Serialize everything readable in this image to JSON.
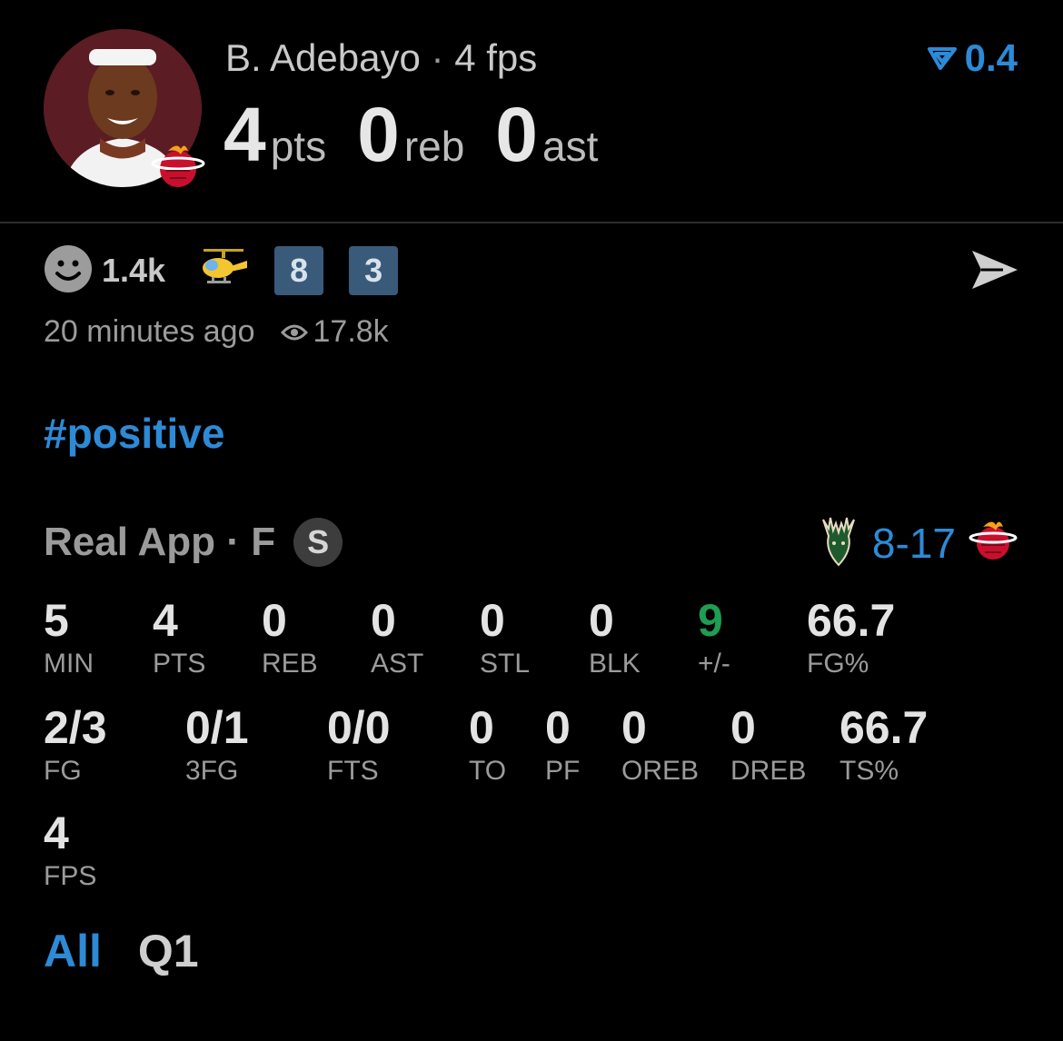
{
  "header": {
    "player_name": "B. Adebayo",
    "separator": "·",
    "fps_label": "4 fps",
    "stats": [
      {
        "value": "4",
        "unit": "pts"
      },
      {
        "value": "0",
        "unit": "reb"
      },
      {
        "value": "0",
        "unit": "ast"
      }
    ],
    "score_chip": "0.4"
  },
  "social": {
    "reaction_count": "1.4k",
    "badges": [
      "8",
      "3"
    ],
    "time_ago": "20 minutes ago",
    "views": "17.8k"
  },
  "hashtag": "#positive",
  "game": {
    "source": "Real App",
    "separator": "·",
    "status": "F",
    "status_badge": "S",
    "score": "8-17"
  },
  "stats_row1": [
    {
      "value": "5",
      "label": "MIN"
    },
    {
      "value": "4",
      "label": "PTS"
    },
    {
      "value": "0",
      "label": "REB"
    },
    {
      "value": "0",
      "label": "AST"
    },
    {
      "value": "0",
      "label": "STL"
    },
    {
      "value": "0",
      "label": "BLK"
    },
    {
      "value": "9",
      "label": "+/-"
    },
    {
      "value": "66.7",
      "label": "FG%"
    }
  ],
  "stats_row2": [
    {
      "value": "2/3",
      "label": "FG"
    },
    {
      "value": "0/1",
      "label": "3FG"
    },
    {
      "value": "0/0",
      "label": "FTS"
    },
    {
      "value": "0",
      "label": "TO"
    },
    {
      "value": "0",
      "label": "PF"
    },
    {
      "value": "0",
      "label": "OREB"
    },
    {
      "value": "0",
      "label": "DREB"
    },
    {
      "value": "66.7",
      "label": "TS%"
    }
  ],
  "stats_row3": [
    {
      "value": "4",
      "label": "FPS"
    }
  ],
  "tabs": [
    "All",
    "Q1"
  ],
  "colors": {
    "accent": "#2d8ad6",
    "positive": "#1e9e52",
    "badge_bg": "#3a5a7a"
  }
}
